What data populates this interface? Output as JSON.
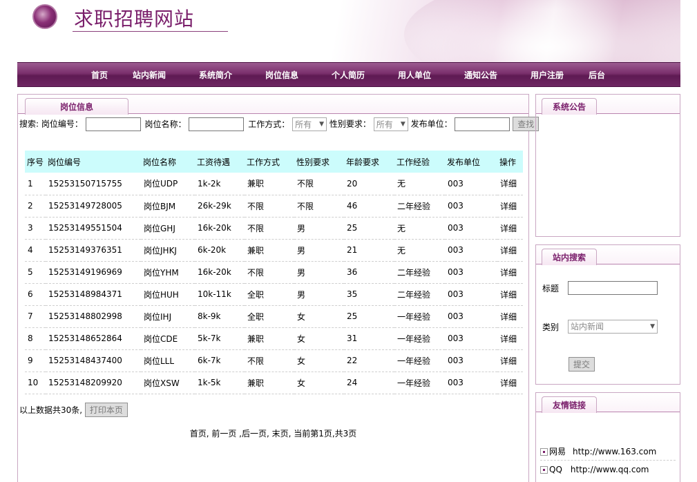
{
  "site": {
    "title": "求职招聘网站"
  },
  "nav": [
    "首页",
    "站内新闻",
    "系统简介",
    "岗位信息",
    "个人简历",
    "用人单位",
    "通知公告",
    "用户注册",
    "后台"
  ],
  "main": {
    "tab": "岗位信息",
    "search": {
      "prefix": "搜索:",
      "job_no_label": "岗位编号：",
      "job_name_label": "岗位名称：",
      "work_mode_label": "工作方式：",
      "work_mode_value": "所有",
      "gender_label": "性别要求：",
      "gender_value": "所有",
      "company_label": "发布单位：",
      "button": "查找"
    },
    "columns": [
      "序号",
      "岗位编号",
      "岗位名称",
      "工资待遇",
      "工作方式",
      "性别要求",
      "年龄要求",
      "工作经验",
      "发布单位",
      "操作"
    ],
    "rows": [
      [
        "1",
        "15253150715755",
        "岗位UDP",
        "1k-2k",
        "兼职",
        "不限",
        "20",
        "无",
        "003",
        "详细"
      ],
      [
        "2",
        "15253149728005",
        "岗位BJM",
        "26k-29k",
        "不限",
        "不限",
        "46",
        "二年经验",
        "003",
        "详细"
      ],
      [
        "3",
        "15253149551504",
        "岗位GHJ",
        "16k-20k",
        "不限",
        "男",
        "25",
        "无",
        "003",
        "详细"
      ],
      [
        "4",
        "15253149376351",
        "岗位JHKJ",
        "6k-20k",
        "兼职",
        "男",
        "21",
        "无",
        "003",
        "详细"
      ],
      [
        "5",
        "15253149196969",
        "岗位YHM",
        "16k-20k",
        "不限",
        "男",
        "36",
        "二年经验",
        "003",
        "详细"
      ],
      [
        "6",
        "15253148984371",
        "岗位HUH",
        "10k-11k",
        "全职",
        "男",
        "35",
        "二年经验",
        "003",
        "详细"
      ],
      [
        "7",
        "15253148802998",
        "岗位IHJ",
        "8k-9k",
        "全职",
        "女",
        "25",
        "一年经验",
        "003",
        "详细"
      ],
      [
        "8",
        "15253148652864",
        "岗位CDE",
        "5k-7k",
        "兼职",
        "女",
        "31",
        "一年经验",
        "003",
        "详细"
      ],
      [
        "9",
        "15253148437400",
        "岗位LLL",
        "6k-7k",
        "不限",
        "女",
        "22",
        "一年经验",
        "003",
        "详细"
      ],
      [
        "10",
        "15253148209920",
        "岗位XSW",
        "1k-5k",
        "兼职",
        "女",
        "24",
        "一年经验",
        "003",
        "详细"
      ]
    ],
    "summary": "以上数据共30条,",
    "print_button": "打印本页",
    "pager": "首页, 前一页 ,后一页, 末页, 当前第1页,共3页"
  },
  "sidebar": {
    "notice_tab": "系统公告",
    "search_tab": "站内搜索",
    "search_title_label": "标题",
    "search_type_label": "类别",
    "search_type_value": "站内新闻",
    "submit_button": "提交",
    "links_tab": "友情链接",
    "links": [
      {
        "name": "网易",
        "url": "http://www.163.com"
      },
      {
        "name": "QQ",
        "url": "http://www.qq.com"
      }
    ]
  }
}
